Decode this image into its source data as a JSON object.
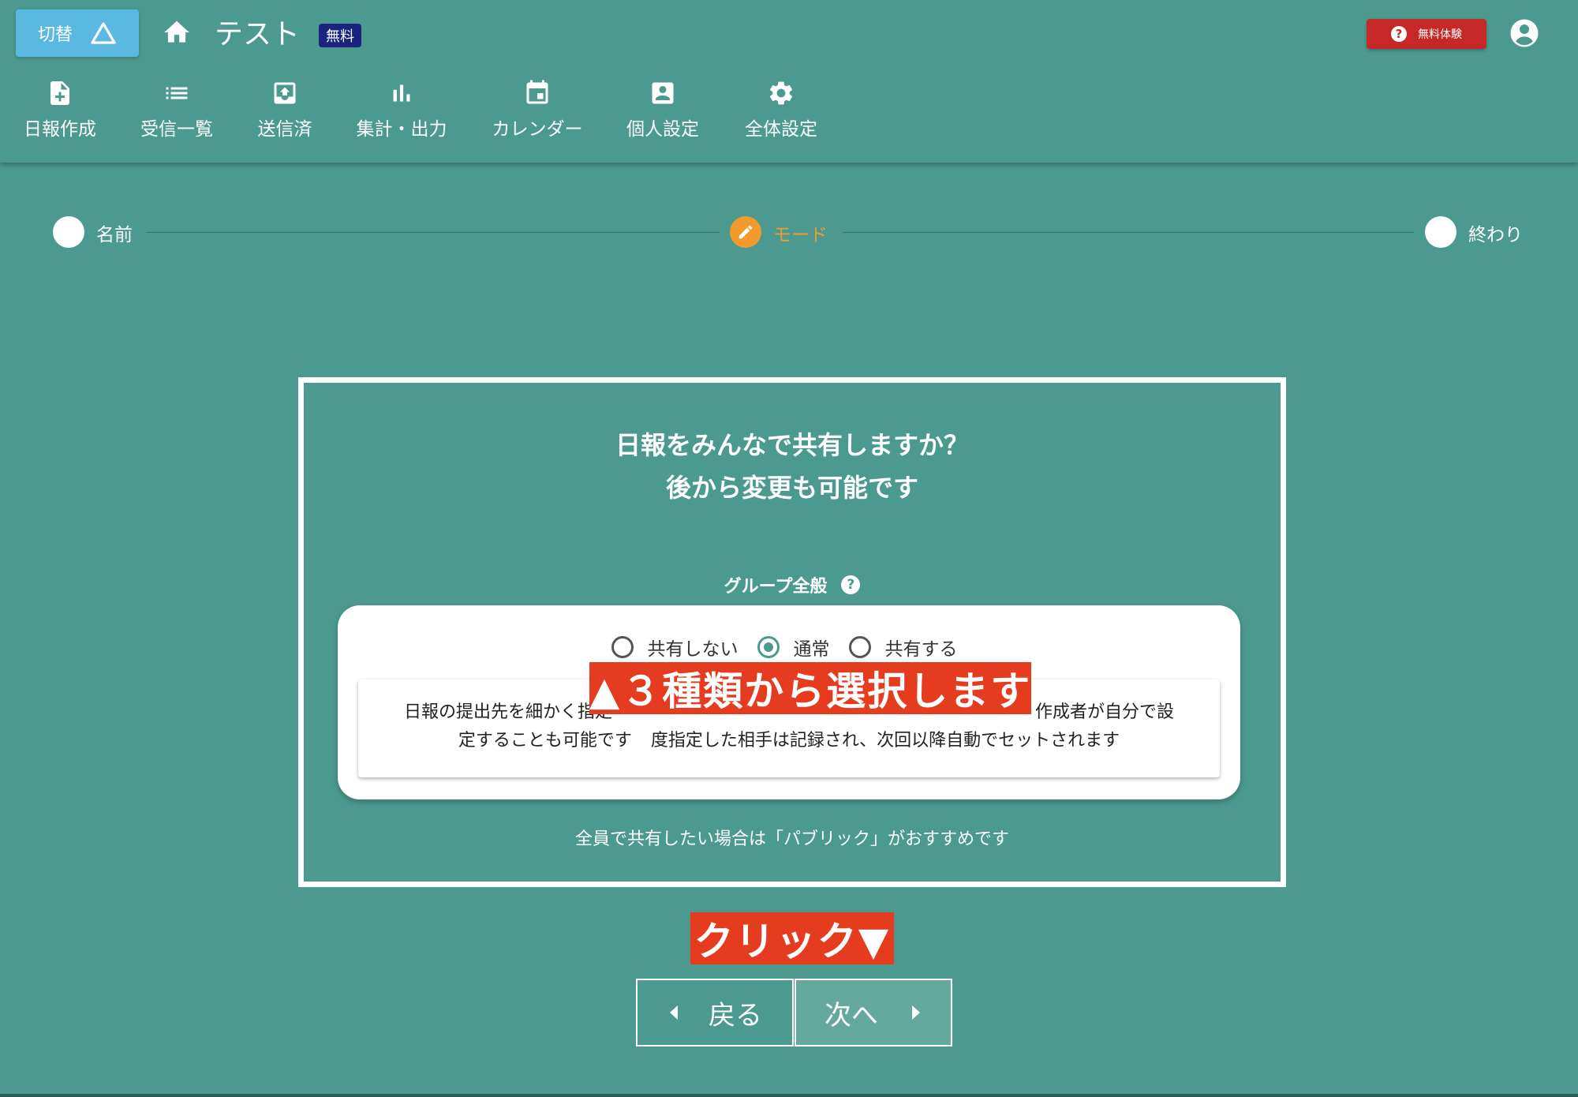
{
  "header": {
    "switch_label": "切替",
    "app_title": "テスト",
    "plan_badge": "無料",
    "trial_label": "無料体験"
  },
  "nav": [
    {
      "label": "日報作成",
      "icon": "note-add-icon"
    },
    {
      "label": "受信一覧",
      "icon": "list-icon"
    },
    {
      "label": "送信済",
      "icon": "outbox-icon"
    },
    {
      "label": "集計・出力",
      "icon": "bar-chart-icon"
    },
    {
      "label": "カレンダー",
      "icon": "calendar-icon"
    },
    {
      "label": "個人設定",
      "icon": "account-box-icon"
    },
    {
      "label": "全体設定",
      "icon": "gear-icon"
    }
  ],
  "stepper": {
    "steps": [
      {
        "label": "名前",
        "state": "done"
      },
      {
        "label": "モード",
        "state": "active"
      },
      {
        "label": "終わり",
        "state": "pending"
      }
    ],
    "active_color": "#f29a2e"
  },
  "main": {
    "question_line1": "日報をみんなで共有しますか？",
    "question_line2": "後から変更も可能です",
    "group_label": "グループ全般",
    "options": [
      {
        "label": "共有しない",
        "checked": false
      },
      {
        "label": "通常",
        "checked": true
      },
      {
        "label": "共有する",
        "checked": false
      }
    ],
    "description_line1": "日報の提出先を細かく指定",
    "description_line1_end": "作成者が自分で設",
    "description_line2": "定することも可能です",
    "description_line2_mid": "度指定した相手は記録され、次回以降自動でセットされます",
    "recommendation": "全員で共有したい場合は「パブリック」がおすすめです"
  },
  "annotations": {
    "overlay_choice": "▲３種類から選択します",
    "overlay_click": "クリック▼",
    "color": "#e53c20"
  },
  "buttons": {
    "back_label": "戻る",
    "next_label": "次へ"
  },
  "colors": {
    "background": "#4c9a8f",
    "trial_button": "#c62828",
    "switch_button": "#59b9e0",
    "badge": "#1a237e"
  }
}
